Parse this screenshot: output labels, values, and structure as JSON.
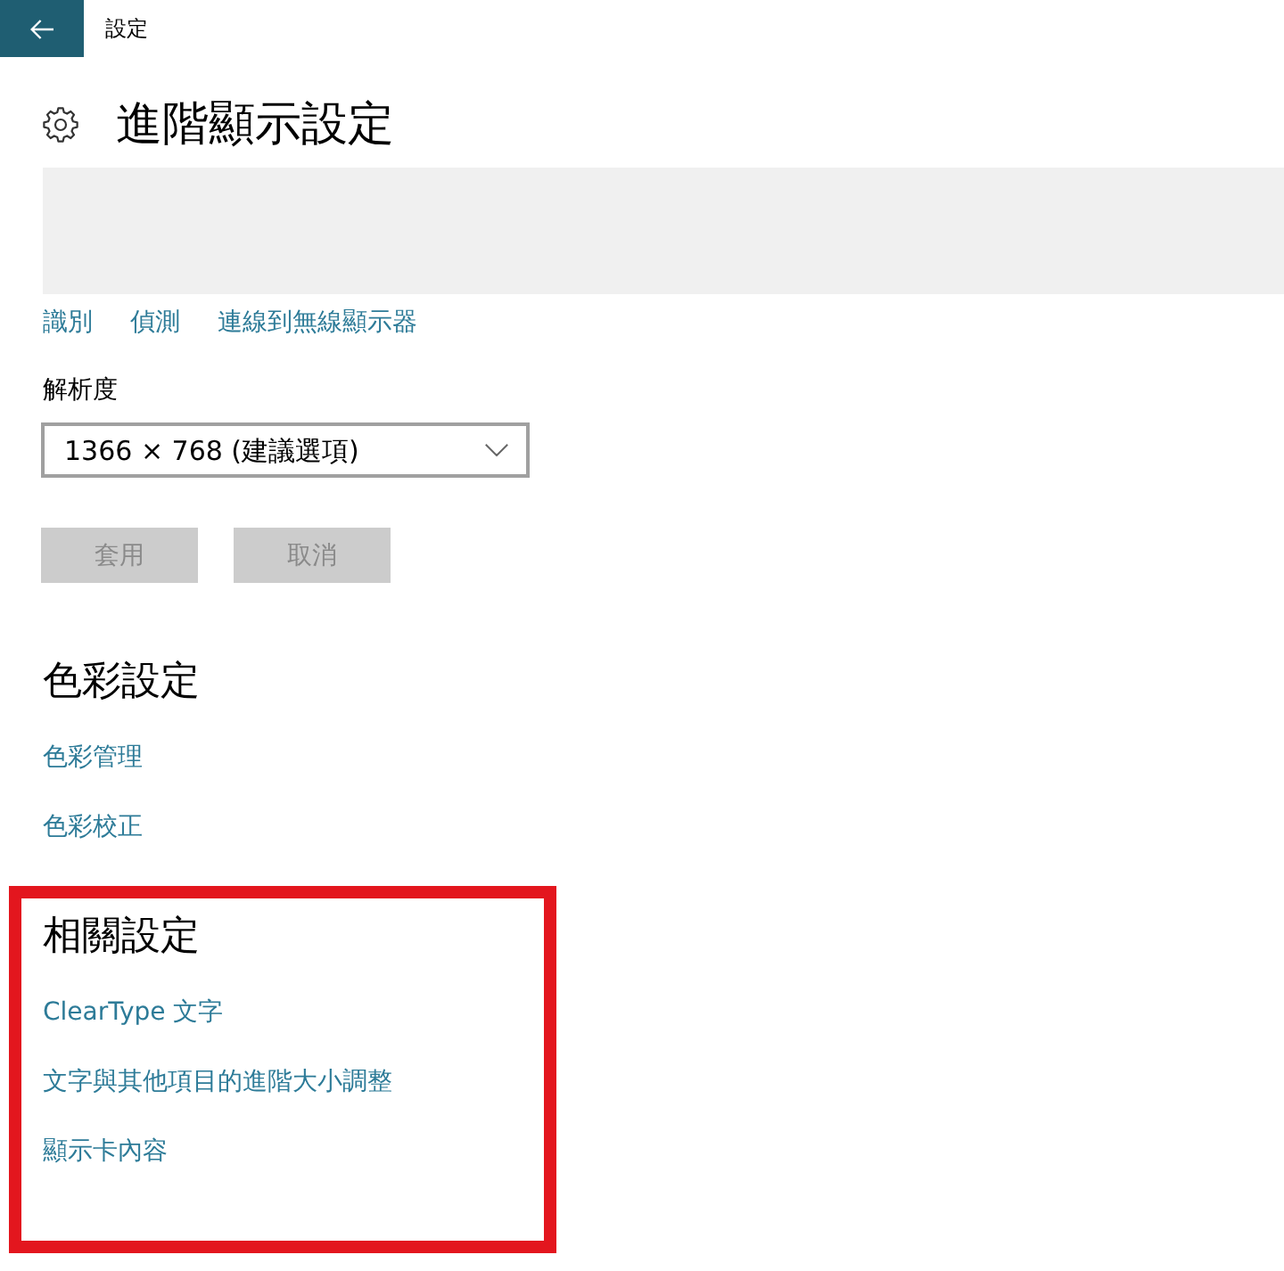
{
  "top_bar": {
    "title": "設定"
  },
  "header": {
    "title": "進階顯示設定"
  },
  "display_links": [
    {
      "label": "識別"
    },
    {
      "label": "偵測"
    },
    {
      "label": "連線到無線顯示器"
    }
  ],
  "resolution": {
    "label": "解析度",
    "value": "1366 × 768 (建議選項)"
  },
  "buttons": [
    {
      "label": "套用",
      "disabled": true
    },
    {
      "label": "取消",
      "disabled": true
    }
  ],
  "sections": [
    {
      "title": "色彩設定",
      "highlighted": false,
      "links": [
        "色彩管理",
        "色彩校正"
      ]
    },
    {
      "title": "相關設定",
      "highlighted": true,
      "links": [
        "ClearType 文字",
        "文字與其他項目的進階大小調整",
        "顯示卡內容"
      ]
    }
  ]
}
